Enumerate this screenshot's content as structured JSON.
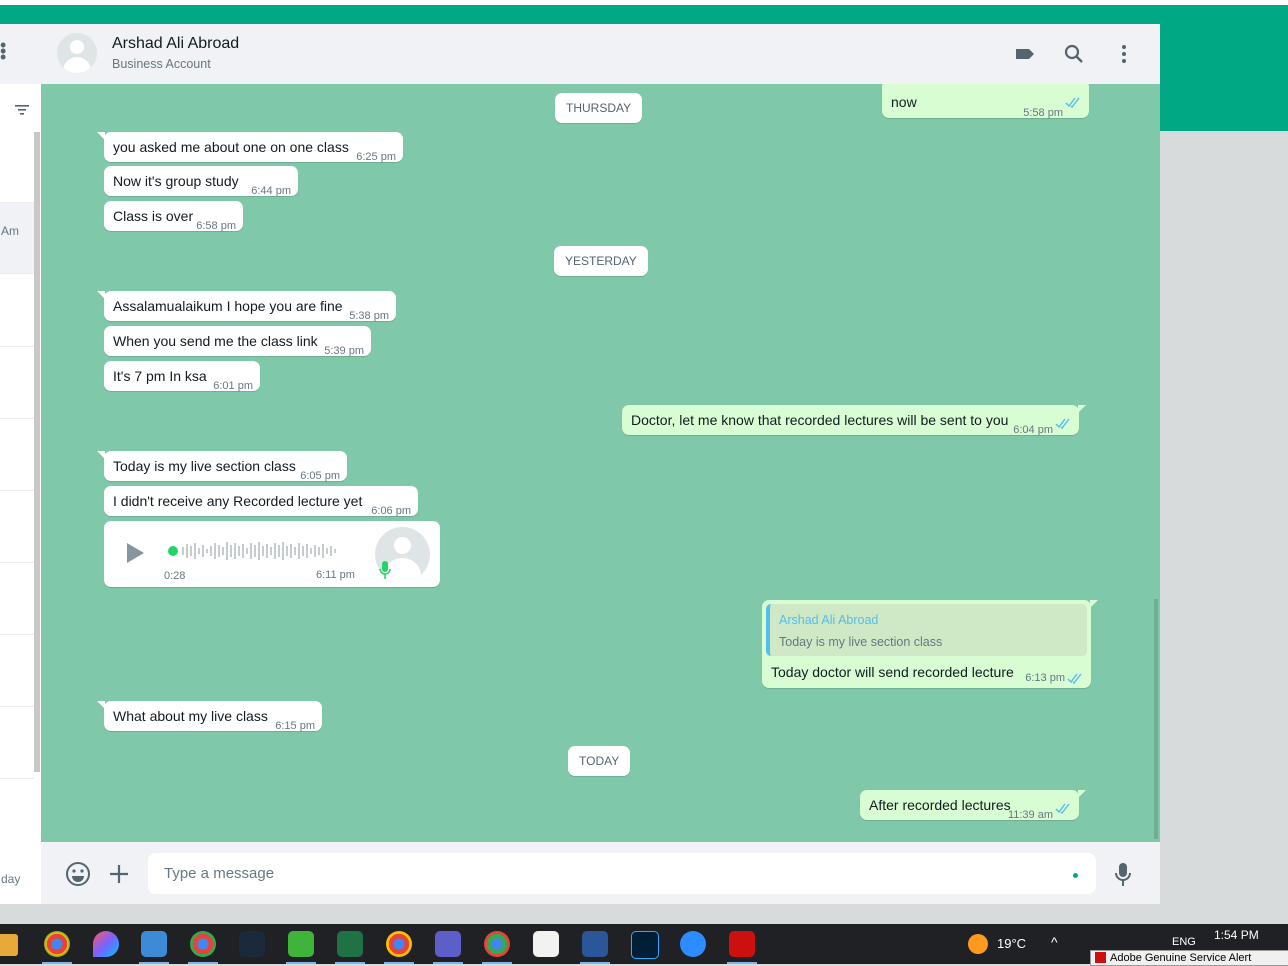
{
  "header": {
    "contact_name": "Arshad Ali Abroad",
    "contact_subtitle": "Business Account",
    "icons": [
      "label-icon",
      "search-icon",
      "menu-icon"
    ]
  },
  "sidebar": {
    "partial_text_1": "Am",
    "partial_text_2": "day"
  },
  "dates": {
    "thursday": "THURSDAY",
    "yesterday": "YESTERDAY",
    "today": "TODAY"
  },
  "messages": [
    {
      "dir": "out",
      "text": "now",
      "time": "5:58 pm"
    },
    {
      "dir": "in",
      "text": "you asked me about one on one class",
      "time": "6:25 pm"
    },
    {
      "dir": "in",
      "text": "Now it's group study",
      "time": "6:44 pm"
    },
    {
      "dir": "in",
      "text": "Class is over",
      "time": "6:58 pm"
    },
    {
      "dir": "in",
      "text": "Assalamualaikum I hope you are fine",
      "time": "5:38 pm"
    },
    {
      "dir": "in",
      "text": "When you send me the class link",
      "time": "5:39 pm"
    },
    {
      "dir": "in",
      "text": "It's 7 pm In ksa",
      "time": "6:01 pm"
    },
    {
      "dir": "out",
      "text": "Doctor, let me know that recorded lectures will be sent to you",
      "time": "6:04 pm"
    },
    {
      "dir": "in",
      "text": "Today is my live section class",
      "time": "6:05 pm"
    },
    {
      "dir": "in",
      "text": "I didn't receive any Recorded lecture yet",
      "time": "6:06 pm"
    },
    {
      "dir": "in",
      "text": "What about my live class",
      "time": "6:15 pm"
    },
    {
      "dir": "out",
      "text": "After recorded lectures",
      "time": "11:39 am"
    }
  ],
  "voice_note": {
    "duration": "0:28",
    "time": "6:11 pm"
  },
  "reply_message": {
    "quoted_author": "Arshad Ali Abroad",
    "quoted_text": "Today is my live section class",
    "text": "Today doctor will send recorded lecture",
    "time": "6:13 pm"
  },
  "composer": {
    "placeholder": "Type a message"
  },
  "taskbar": {
    "apps": [
      "chrome-icon",
      "paint-drop-icon",
      "photos-icon",
      "chrome-profile-icon",
      "arrow-app-icon",
      "camtasia-icon",
      "excel-icon",
      "chrome-profile-2-icon",
      "teams-icon",
      "chrome-profile-3-icon",
      "acrobat-icon",
      "word-icon",
      "photoshop-icon",
      "zoom-icon",
      "adobe-icon"
    ],
    "temperature": "19°C",
    "language": "ENG",
    "time": "1:54 PM",
    "alert": "Adobe Genuine Service Alert"
  },
  "colors": {
    "brand_green": "#00a884",
    "chat_bg": "#7fc8a9",
    "outgoing_bubble": "#d9fdd3",
    "tick_blue": "#53bdeb"
  }
}
